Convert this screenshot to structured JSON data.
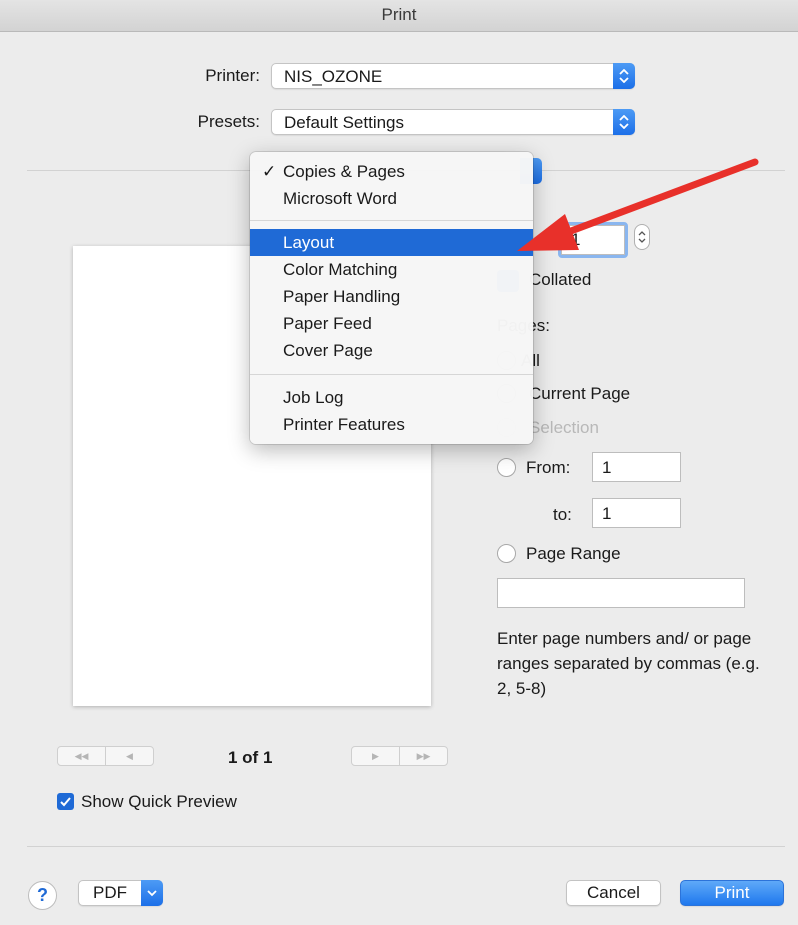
{
  "window": {
    "title": "Print"
  },
  "printer": {
    "label": "Printer:",
    "value": "NIS_OZONE"
  },
  "presets": {
    "label": "Presets:",
    "value": "Default Settings"
  },
  "menu": {
    "items": [
      {
        "label": "Copies & Pages",
        "checked": true
      },
      {
        "label": "Microsoft Word"
      },
      {
        "label": "Layout",
        "highlighted": true
      },
      {
        "label": "Color Matching"
      },
      {
        "label": "Paper Handling"
      },
      {
        "label": "Paper Feed"
      },
      {
        "label": "Cover Page"
      },
      {
        "label": "Job Log"
      },
      {
        "label": "Printer Features"
      }
    ],
    "check_glyph": "✓"
  },
  "copies": {
    "value": "1",
    "collated_label": "Collated"
  },
  "pages": {
    "label": "Pages:",
    "all_label": "All",
    "current_page_label": "Current Page",
    "selection_label": "Selection",
    "from_label": "From:",
    "from_value": "1",
    "to_label": "to:",
    "to_value": "1",
    "page_range_label": "Page Range",
    "page_range_value": "",
    "hint": "Enter page numbers and/ or page ranges separated by commas (e.g. 2, 5-8)"
  },
  "preview": {
    "page_indicator": "1 of 1"
  },
  "quick_preview": {
    "label": "Show Quick Preview",
    "checked": true
  },
  "footer": {
    "help_label": "?",
    "pdf_label": "PDF",
    "cancel_label": "Cancel",
    "print_label": "Print"
  },
  "colors": {
    "accent": "#1f6ad6",
    "arrow": "#e8302a"
  }
}
